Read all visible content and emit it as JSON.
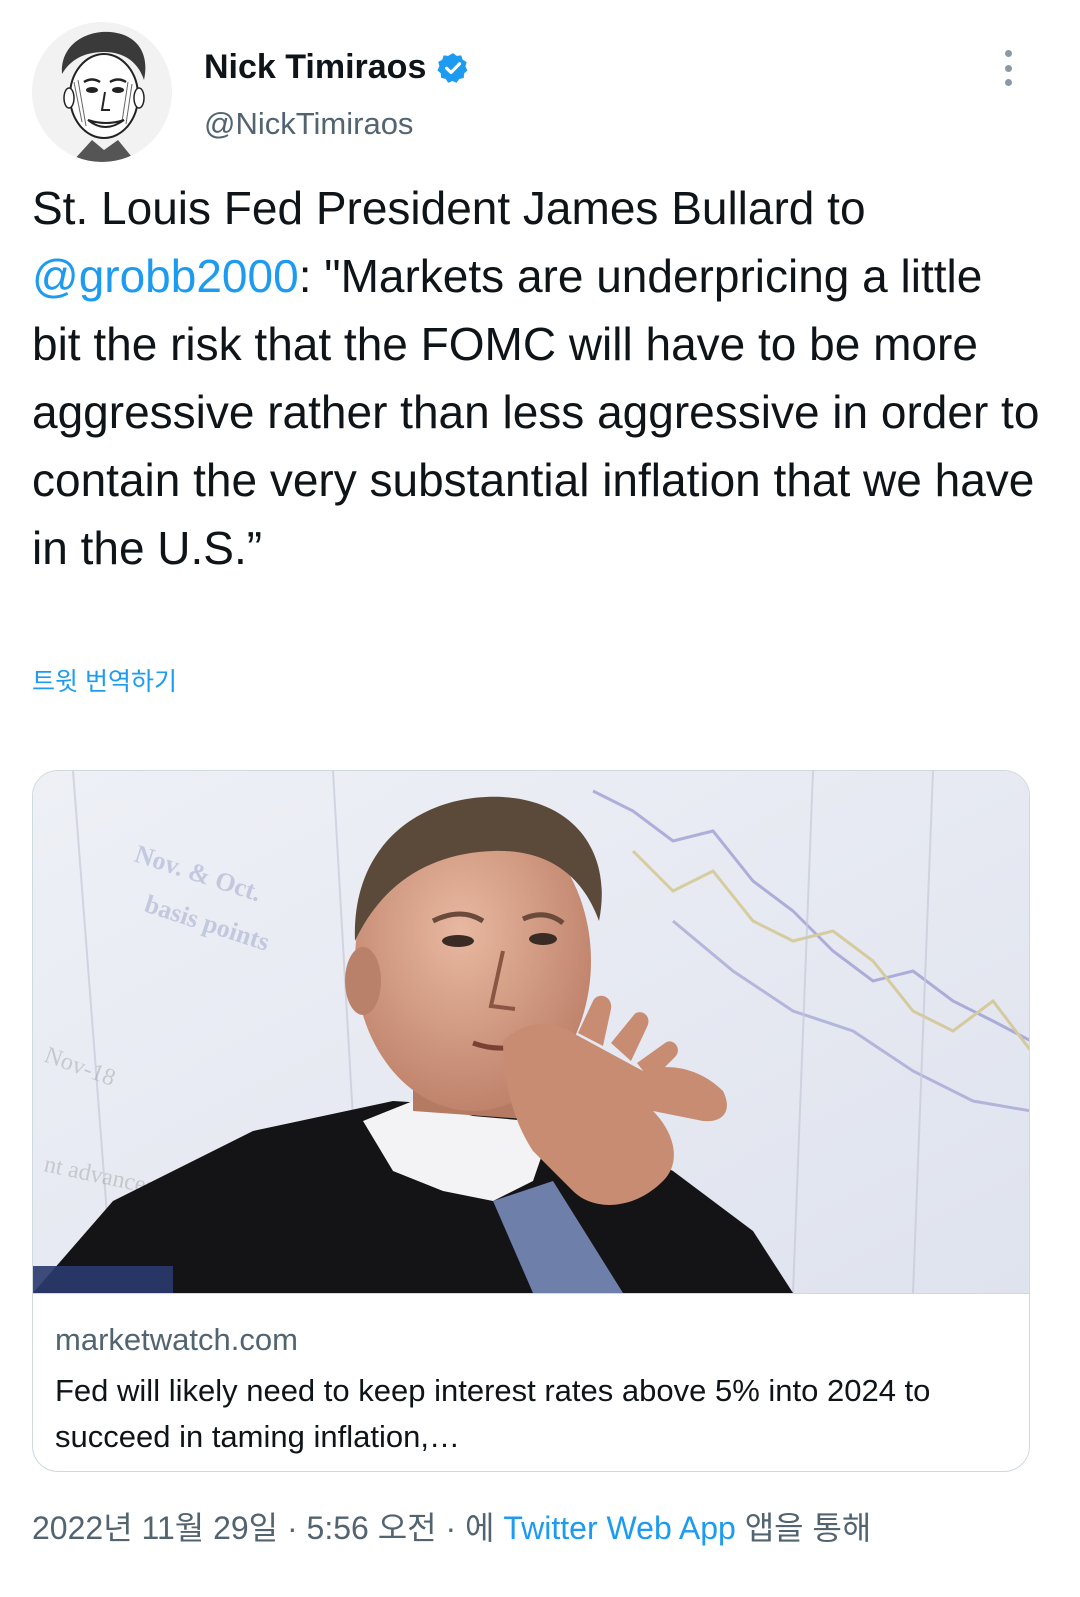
{
  "author": {
    "name": "Nick Timiraos",
    "handle": "@NickTimiraos",
    "verified": true
  },
  "tweet": {
    "text_before": "St. Louis Fed President James Bullard to ",
    "mention": "@grobb2000",
    "text_after": ":  \"Markets are underpricing a little bit the risk that the FOMC will have to be more aggressive rather than less aggressive in order to contain the very substantial inflation that we have in the U.S.”",
    "translate_label": "트윗 번역하기"
  },
  "card": {
    "domain": "marketwatch.com",
    "title": "Fed will likely need to keep interest rates above 5% into 2024 to succeed in taming inflation,…"
  },
  "footer": {
    "date": "2022년 11월 29일",
    "separator1": " · ",
    "time": "5:56 오전",
    "separator2": " · ",
    "via_prefix": "에 ",
    "source_app": "Twitter Web App",
    "via_suffix": " 앱을 통해"
  },
  "colors": {
    "accent": "#1d9bf0",
    "secondary_text": "#536471",
    "primary_text": "#0f1419",
    "border": "#cfd9de"
  },
  "icons": [
    "verified-badge-icon",
    "more-options-icon"
  ]
}
